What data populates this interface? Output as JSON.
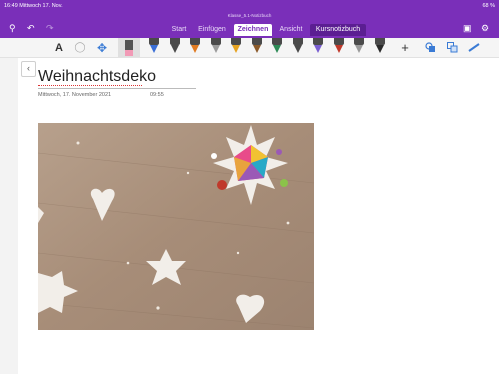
{
  "status_bar": {
    "time_date": "16:49  Mittwoch 17. Nov.",
    "battery": "68 %"
  },
  "window": {
    "notebook_title": "Klasse_5.1-Notizbuch"
  },
  "tabs": [
    "Start",
    "Einfügen",
    "Zeichnen",
    "Ansicht",
    "Kursnotizbuch"
  ],
  "active_tab": "Zeichnen",
  "toolbar_icons": [
    "text-icon",
    "lasso-icon",
    "move-icon",
    "eraser-icon",
    "pen-icon",
    "add-icon",
    "shapes-icon",
    "convert-icon",
    "ruler-icon"
  ],
  "pen_colors": [
    "#3b6fd6",
    "#4a4a4a",
    "#e07b22",
    "#9b9b9b",
    "#e6a321",
    "#8a5a2b",
    "#2e8b57",
    "#4a4a4a",
    "#7a5fd1",
    "#c0392b",
    "#9a9a9a",
    "#2b2b2b"
  ],
  "page": {
    "title": "Weihnachtsdeko",
    "date": "Mittwoch, 17. November 2021",
    "time": "09:55"
  },
  "photo": {
    "icon": "photo-icon"
  },
  "colors": {
    "accent": "#7a2fb9",
    "background": "#ffffff"
  }
}
